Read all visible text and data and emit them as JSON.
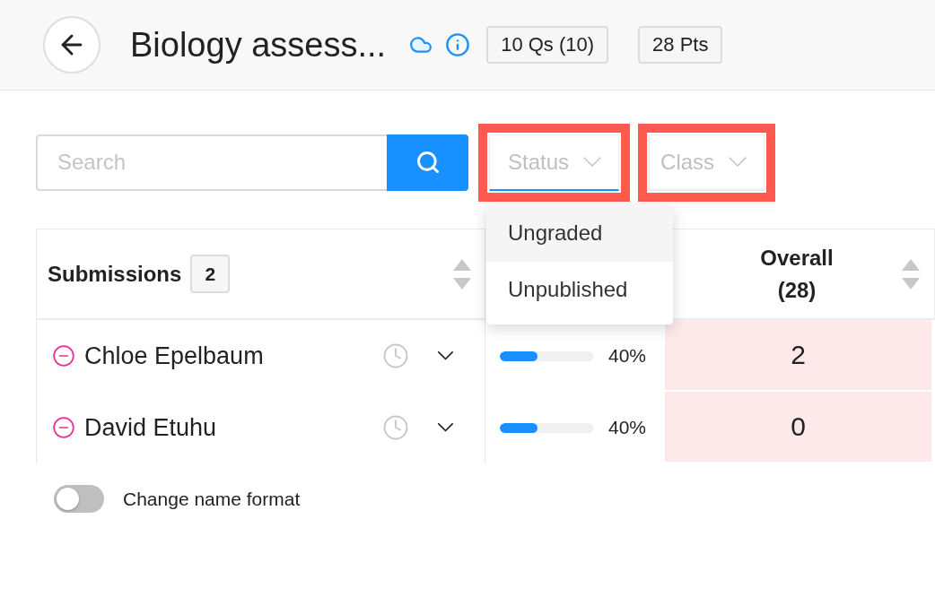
{
  "header": {
    "title": "Biology assess...",
    "badges": [
      "10 Qs (10)",
      "28 Pts"
    ]
  },
  "filters": {
    "search": {
      "placeholder": "Search"
    },
    "dropdowns": [
      {
        "label": "Status",
        "open": true,
        "highlighted": true,
        "options": [
          {
            "label": "Ungraded",
            "selected": true
          },
          {
            "label": "Unpublished",
            "selected": false
          }
        ]
      },
      {
        "label": "Class",
        "open": false,
        "highlighted": true
      }
    ]
  },
  "table": {
    "submissions_header": {
      "title": "Submissions",
      "count": "2"
    },
    "overall_header": {
      "title": "Overall",
      "points": "(28)"
    },
    "rows": [
      {
        "name": "Chloe Epelbaum",
        "progress": {
          "level": 0.4
        },
        "percent": "40%",
        "overall": "2"
      },
      {
        "name": "David Etuhu",
        "progress": {
          "level": 0.4
        },
        "percent": "40%",
        "overall": "0"
      }
    ]
  },
  "name_format": {
    "label": "Change name format",
    "on": false
  }
}
